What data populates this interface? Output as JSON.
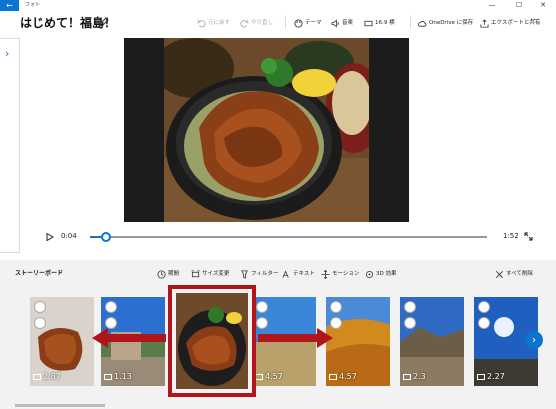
{
  "window": {
    "app_title": "フォト",
    "back_glyph": "←",
    "minimize_glyph": "—",
    "maximize_glyph": "☐",
    "close_glyph": "✕"
  },
  "project": {
    "title": "はじめて！福島！"
  },
  "toolbar": {
    "undo": "元に戻す",
    "redo": "やり直し",
    "theme": "テーマ",
    "music": "音楽",
    "aspect": "16:9 横",
    "save_onedrive": "OneDrive に保存",
    "export_share": "エクスポートと共有",
    "more": "···"
  },
  "side_panel": {
    "chevron": "›"
  },
  "player": {
    "current_time": "0:04",
    "total_time": "1:52",
    "progress": 0.04
  },
  "storyboard": {
    "title": "ストーリーボード",
    "tools": {
      "duration": "期間",
      "resize": "サイズ変更",
      "filter": "フィルター",
      "text": "テキスト",
      "motion": "モーション",
      "effects_3d": "3D 効果",
      "remove_all": "すべて削除"
    },
    "next_glyph": "›",
    "cards": [
      {
        "duration": "2.87"
      },
      {
        "duration": "1.13"
      },
      {
        "duration": ""
      },
      {
        "duration": "4.57"
      },
      {
        "duration": "4.57"
      },
      {
        "duration": "2.3"
      },
      {
        "duration": "2.27"
      }
    ]
  },
  "colors": {
    "accent": "#0a74cf",
    "highlight": "#b0151c"
  }
}
